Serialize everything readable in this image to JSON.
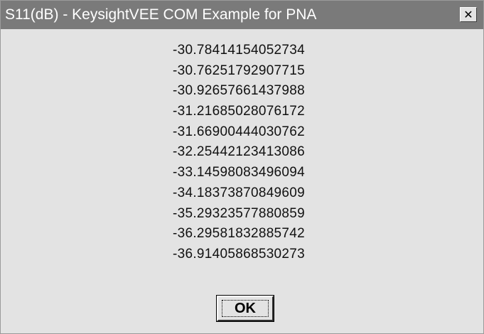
{
  "window": {
    "title": "S11(dB) - KeysightVEE COM Example for PNA",
    "close_glyph": "✕",
    "close_icon": "close-icon"
  },
  "values": [
    "-30.78414154052734",
    "-30.76251792907715",
    "-30.92657661437988",
    "-31.21685028076172",
    "-31.66900444030762",
    "-32.25442123413086",
    "-33.14598083496094",
    "-34.18373870849609",
    "-35.29323577880859",
    "-36.29581832885742",
    "-36.91405868530273"
  ],
  "buttons": {
    "ok_label": "OK"
  },
  "colors": {
    "title_bar": "#7a7a7a",
    "title_text": "#ffffff",
    "dialog_background": "#e3e3e3"
  }
}
